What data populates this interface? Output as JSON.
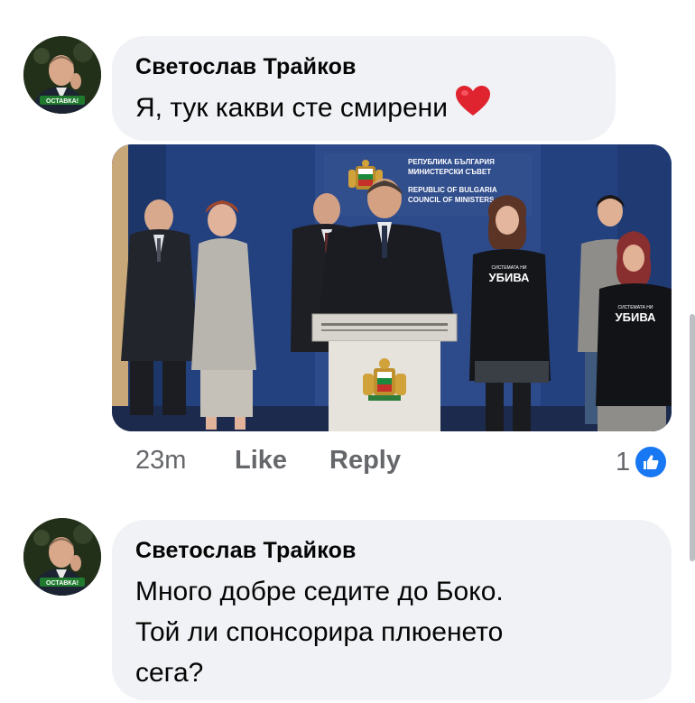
{
  "comments": [
    {
      "author": "Светослав Трайков",
      "text": "Я, тук какви сте смирени",
      "emoji": "heart-emoji",
      "avatar_badge": "ОСТАВКА!",
      "time": "23m",
      "like_label": "Like",
      "reply_label": "Reply",
      "reaction_count": "1",
      "photo": {
        "backdrop_lines": [
          "РЕПУБЛИКА БЪЛГАРИЯ",
          "МИНИСТЕРСКИ СЪВЕТ",
          "REPUBLIC OF BULGARIA",
          "COUNCIL OF MINISTERS"
        ],
        "shirt_text": "УБИВА",
        "shirt_small_text": "СИСТЕМАТА НИ"
      }
    },
    {
      "author": "Светослав Трайков",
      "text_lines": [
        "Много добре седите до Боко.",
        "Той ли спонсорира плюенето",
        "сега?"
      ],
      "avatar_badge": "ОСТАВКА!"
    }
  ],
  "colors": {
    "bubble": "#f0f2f5",
    "meta": "#65676b",
    "like_blue": "#1877f2"
  }
}
